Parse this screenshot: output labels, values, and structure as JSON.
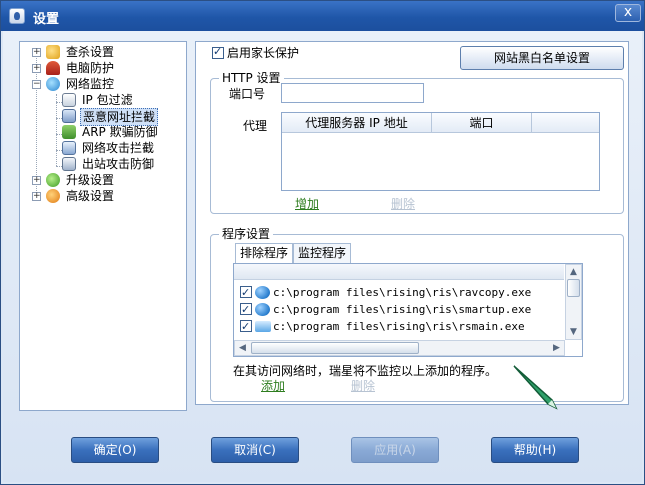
{
  "window": {
    "title": "设置",
    "close_label": "x"
  },
  "tree": {
    "items": [
      {
        "label": "查杀设置"
      },
      {
        "label": "电脑防护"
      },
      {
        "label": "网络监控"
      },
      {
        "label": "IP 包过滤"
      },
      {
        "label": "恶意网址拦截"
      },
      {
        "label": "ARP 欺骗防御"
      },
      {
        "label": "网络攻击拦截"
      },
      {
        "label": "出站攻击防御"
      },
      {
        "label": "升级设置"
      },
      {
        "label": "高级设置"
      }
    ],
    "expander_plus": "+",
    "expander_minus": "−"
  },
  "panel": {
    "parental_control": {
      "label": "启用家长保护",
      "checked": true
    },
    "whitelist_button": "网站黑白名单设置",
    "http": {
      "legend": "HTTP 设置",
      "port_label": "端口号",
      "port_value": "",
      "proxy_label": "代理",
      "columns": [
        "代理服务器 IP 地址",
        "端口"
      ],
      "add_link": "增加",
      "delete_link": "删除"
    },
    "program": {
      "legend": "程序设置",
      "tabs": [
        "排除程序",
        "监控程序"
      ],
      "rows": [
        {
          "path": "c:\\program files\\rising\\ris\\ravcopy.exe",
          "checked": true
        },
        {
          "path": "c:\\program files\\rising\\ris\\smartup.exe",
          "checked": true
        },
        {
          "path": "c:\\program files\\rising\\ris\\rsmain.exe",
          "checked": true
        }
      ],
      "note": "在其访问网络时，瑞星将不监控以上添加的程序。",
      "add_link": "添加",
      "delete_link": "删除"
    }
  },
  "buttons": {
    "ok": "确定(O)",
    "cancel": "取消(C)",
    "apply": "应用(A)",
    "help": "帮助(H)"
  },
  "colors": {
    "title_bar": "#2c62b4",
    "link_green": "#2e7d1f",
    "link_disabled": "#b7c3d2",
    "selection": "#cfe0f7"
  }
}
